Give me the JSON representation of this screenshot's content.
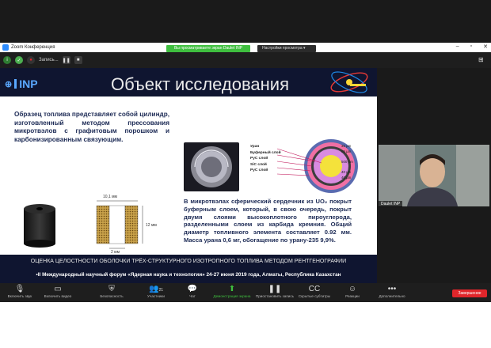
{
  "window": {
    "title": "Zoom Конференция",
    "controls": [
      "–",
      "▫",
      "✕"
    ]
  },
  "share_banner": {
    "status": "Вы просматриваете экран Daulet INP",
    "view_options": "Настройки просмотра ▾"
  },
  "recording": {
    "label": "Запись..."
  },
  "slide": {
    "logo": "INP",
    "title": "Объект исследования",
    "paragraph1": "Образец топлива представляет собой цилиндр, изготовленный методом прессования микротвэлов с графитовым порошком и карбонизированным связующим.",
    "paragraph2": "В микротвэлах сферический сердечник из UO₂ покрыт буферным слоем, который, в свою очередь, покрыт двумя слоями высокоплотного пироуглерода, разделенными слоем из карбида кремния. Общий диаметр топливного элемента составляет 0.92 мм. Масса урана 0,6 мг, обогащение по урану-235 9,9%.",
    "xsec_labels": {
      "top": "10,1 мм",
      "right": "12 мм",
      "bottom": "2 мм"
    },
    "layers": [
      "Уран",
      "Буферный слой",
      "PyC слой",
      "SiC слой",
      "PyC слой"
    ],
    "dims": [
      "35 µm",
      "95 µm",
      "500 µm",
      "40 µm",
      "40 µm"
    ],
    "footer_title": "ОЦЕНКА ЦЕЛОСТНОСТИ ОБОЛОЧКИ ТРЁХ-СТРУКТУРНОГО ИЗОТРОПНОГО ТОПЛИВА МЕТОДОМ РЕНТГЕНОГРАФИИ",
    "footer_forum": "•II Международный научный форум «Ядерная наука и технологии» 24-27 июня 2019 года, Алматы, Республика Казахстан"
  },
  "participant": {
    "name": "Daulet INP"
  },
  "toolbar": {
    "items": [
      {
        "label": "Включить звук",
        "icon": "mic-off-icon"
      },
      {
        "label": "Включить видео",
        "icon": "video-off-icon"
      },
      {
        "label": "Безопасность",
        "icon": "shield-icon"
      },
      {
        "label": "Участники",
        "icon": "participants-icon",
        "count": "21"
      },
      {
        "label": "Чат",
        "icon": "chat-icon"
      },
      {
        "label": "Демонстрация экрана",
        "icon": "share-screen-icon"
      },
      {
        "label": "Приостановить запись",
        "icon": "pause-record-icon"
      },
      {
        "label": "Скрытые субтитры",
        "icon": "cc-icon"
      },
      {
        "label": "Реакции",
        "icon": "reaction-icon"
      },
      {
        "label": "Дополнительно",
        "icon": "more-icon"
      }
    ],
    "end_label": "Завершение"
  }
}
